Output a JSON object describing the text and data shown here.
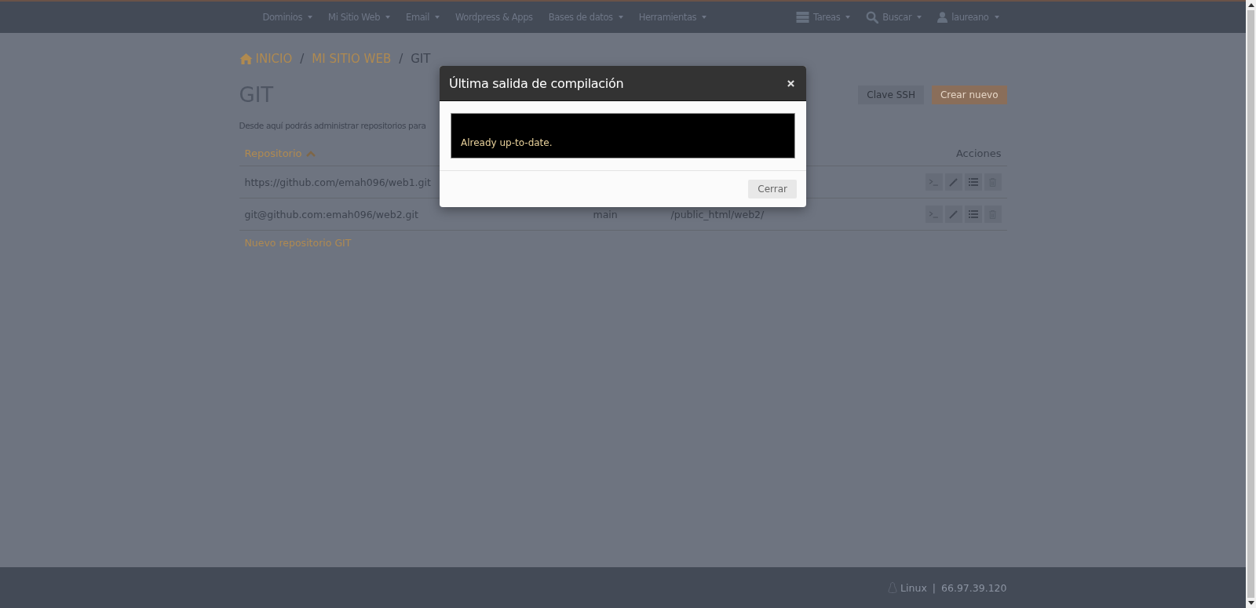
{
  "navbar": {
    "menu": [
      {
        "label": "Dominios",
        "dropdown": true
      },
      {
        "label": "Mi Sitio Web",
        "dropdown": true
      },
      {
        "label": "Email",
        "dropdown": true
      },
      {
        "label": "Wordpress & Apps",
        "dropdown": false
      },
      {
        "label": "Bases de datos",
        "dropdown": true
      },
      {
        "label": "Herramientas",
        "dropdown": true
      }
    ],
    "right": [
      {
        "kind": "tasks",
        "label": "Tareas"
      },
      {
        "kind": "search",
        "label": "Buscar"
      },
      {
        "kind": "user",
        "label": "laureano"
      }
    ]
  },
  "breadcrumb": [
    {
      "label": "INICIO",
      "link": true
    },
    {
      "separator_before": "/",
      "label": "MI SITIO WEB",
      "link": true
    },
    {
      "separator_before": "/",
      "label": "GIT",
      "link": false
    }
  ],
  "page": {
    "title": "GIT",
    "description": "Desde aquí podrás administrar repositorios para",
    "buttons": [
      {
        "kind": "default",
        "label": "Clave SSH"
      },
      {
        "kind": "primary",
        "label": "Crear nuevo"
      }
    ]
  },
  "table": {
    "columns": {
      "repository": "Repositorio",
      "actions": "Acciones"
    },
    "rows": [
      {
        "repository": "https://github.com/emah096/web1.git"
      },
      {
        "repository": "git@github.com:emah096/web2.git",
        "column_2": "main",
        "column_3": "/public_html/web2/"
      }
    ],
    "add_link": "Nuevo repositorio GIT"
  },
  "modal": {
    "title": "Última salida de compilación",
    "output": "Already up-to-date.",
    "close_button": "Cerrar"
  },
  "footer": {
    "os": "Linux",
    "separator": "|",
    "ip": "66.97.39.120"
  }
}
